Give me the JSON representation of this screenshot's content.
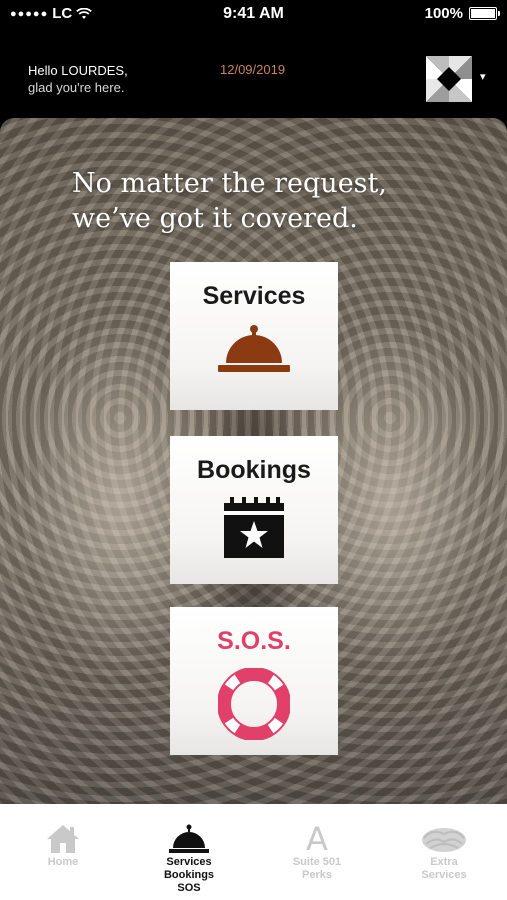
{
  "status_bar": {
    "signal_dots": "●●●●●",
    "carrier": "LC",
    "wifi_icon": "wifi-icon",
    "time": "9:41 AM",
    "battery_text": "100%",
    "battery_level": 1.0
  },
  "header": {
    "greeting_line1": "Hello LOURDES,",
    "greeting_line2": "glad you're here.",
    "date": "12/09/2019",
    "logo_icon": "hotel-logo-icon",
    "menu_caret": "▾"
  },
  "hero": {
    "tagline_line1": "No matter the request,",
    "tagline_line2": "we’ve got it covered."
  },
  "tiles": [
    {
      "label": "Services",
      "icon": "service-bell-icon",
      "color": "#8b3a12"
    },
    {
      "label": "Bookings",
      "icon": "calendar-star-icon",
      "color": "#111111"
    },
    {
      "label": "S.O.S.",
      "icon": "life-ring-icon",
      "color": "#e0406a"
    }
  ],
  "tabbar": {
    "tabs": [
      {
        "label": "Home",
        "icon": "home-icon",
        "active": false
      },
      {
        "label_lines": [
          "Services",
          "Bookings",
          "SOS"
        ],
        "icon": "service-bell-icon",
        "active": true
      },
      {
        "label_lines": [
          "Suite 501",
          "Perks"
        ],
        "icon": "letter-a-icon",
        "glyph": "A",
        "active": false
      },
      {
        "label_lines": [
          "Extra",
          "Services"
        ],
        "icon": "nest-icon",
        "active": false
      }
    ]
  },
  "colors": {
    "accent_date": "#c8855a",
    "sos_pink": "#e0406a",
    "bell_brown": "#8b3a12",
    "inactive_tab": "#c9c9c9"
  }
}
